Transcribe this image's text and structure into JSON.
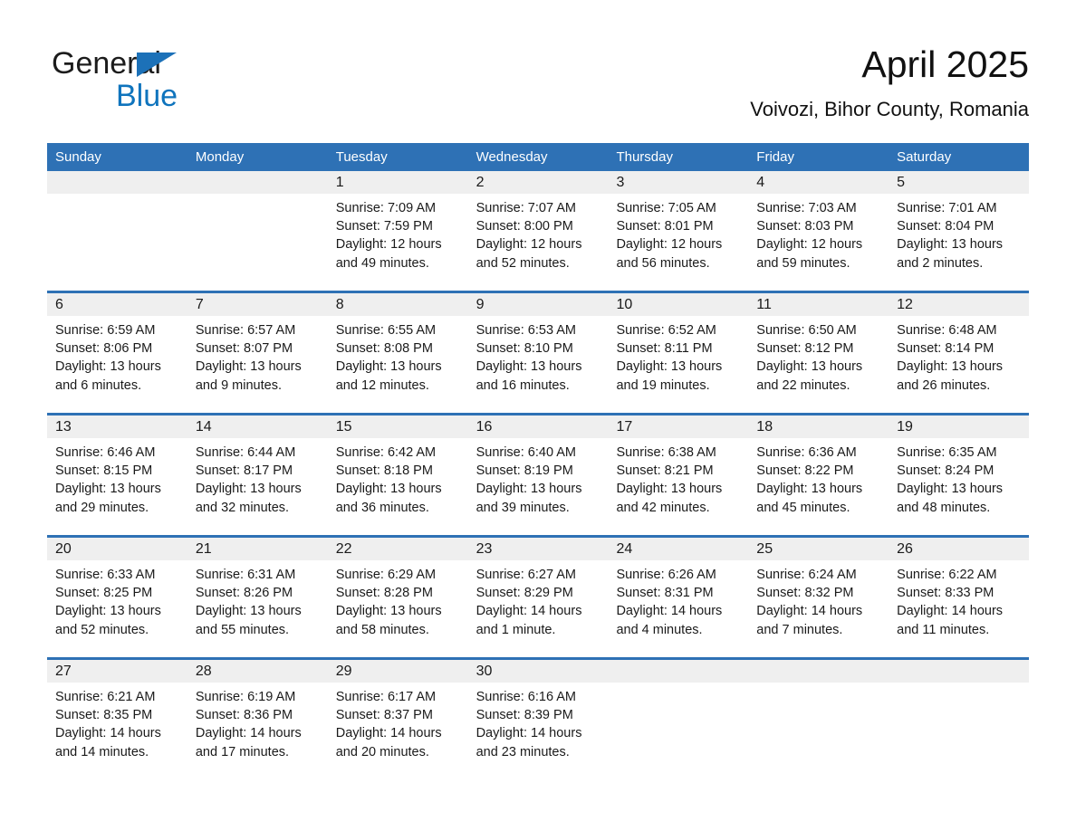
{
  "brand": {
    "name_part1": "General",
    "name_part2": "Blue",
    "logo_icon": "triangle-logo-icon",
    "accent_color": "#1c71b8"
  },
  "header": {
    "title": "April 2025",
    "subtitle": "Voivozi, Bihor County, Romania"
  },
  "theme": {
    "header_blue": "#2e71b5",
    "daynum_band": "#efefef",
    "text": "#1a1a1a"
  },
  "calendar": {
    "weekdays": [
      "Sunday",
      "Monday",
      "Tuesday",
      "Wednesday",
      "Thursday",
      "Friday",
      "Saturday"
    ],
    "weeks": [
      [
        {
          "day": "",
          "lines": []
        },
        {
          "day": "",
          "lines": []
        },
        {
          "day": "1",
          "lines": [
            "Sunrise: 7:09 AM",
            "Sunset: 7:59 PM",
            "Daylight: 12 hours",
            "and 49 minutes."
          ]
        },
        {
          "day": "2",
          "lines": [
            "Sunrise: 7:07 AM",
            "Sunset: 8:00 PM",
            "Daylight: 12 hours",
            "and 52 minutes."
          ]
        },
        {
          "day": "3",
          "lines": [
            "Sunrise: 7:05 AM",
            "Sunset: 8:01 PM",
            "Daylight: 12 hours",
            "and 56 minutes."
          ]
        },
        {
          "day": "4",
          "lines": [
            "Sunrise: 7:03 AM",
            "Sunset: 8:03 PM",
            "Daylight: 12 hours",
            "and 59 minutes."
          ]
        },
        {
          "day": "5",
          "lines": [
            "Sunrise: 7:01 AM",
            "Sunset: 8:04 PM",
            "Daylight: 13 hours",
            "and 2 minutes."
          ]
        }
      ],
      [
        {
          "day": "6",
          "lines": [
            "Sunrise: 6:59 AM",
            "Sunset: 8:06 PM",
            "Daylight: 13 hours",
            "and 6 minutes."
          ]
        },
        {
          "day": "7",
          "lines": [
            "Sunrise: 6:57 AM",
            "Sunset: 8:07 PM",
            "Daylight: 13 hours",
            "and 9 minutes."
          ]
        },
        {
          "day": "8",
          "lines": [
            "Sunrise: 6:55 AM",
            "Sunset: 8:08 PM",
            "Daylight: 13 hours",
            "and 12 minutes."
          ]
        },
        {
          "day": "9",
          "lines": [
            "Sunrise: 6:53 AM",
            "Sunset: 8:10 PM",
            "Daylight: 13 hours",
            "and 16 minutes."
          ]
        },
        {
          "day": "10",
          "lines": [
            "Sunrise: 6:52 AM",
            "Sunset: 8:11 PM",
            "Daylight: 13 hours",
            "and 19 minutes."
          ]
        },
        {
          "day": "11",
          "lines": [
            "Sunrise: 6:50 AM",
            "Sunset: 8:12 PM",
            "Daylight: 13 hours",
            "and 22 minutes."
          ]
        },
        {
          "day": "12",
          "lines": [
            "Sunrise: 6:48 AM",
            "Sunset: 8:14 PM",
            "Daylight: 13 hours",
            "and 26 minutes."
          ]
        }
      ],
      [
        {
          "day": "13",
          "lines": [
            "Sunrise: 6:46 AM",
            "Sunset: 8:15 PM",
            "Daylight: 13 hours",
            "and 29 minutes."
          ]
        },
        {
          "day": "14",
          "lines": [
            "Sunrise: 6:44 AM",
            "Sunset: 8:17 PM",
            "Daylight: 13 hours",
            "and 32 minutes."
          ]
        },
        {
          "day": "15",
          "lines": [
            "Sunrise: 6:42 AM",
            "Sunset: 8:18 PM",
            "Daylight: 13 hours",
            "and 36 minutes."
          ]
        },
        {
          "day": "16",
          "lines": [
            "Sunrise: 6:40 AM",
            "Sunset: 8:19 PM",
            "Daylight: 13 hours",
            "and 39 minutes."
          ]
        },
        {
          "day": "17",
          "lines": [
            "Sunrise: 6:38 AM",
            "Sunset: 8:21 PM",
            "Daylight: 13 hours",
            "and 42 minutes."
          ]
        },
        {
          "day": "18",
          "lines": [
            "Sunrise: 6:36 AM",
            "Sunset: 8:22 PM",
            "Daylight: 13 hours",
            "and 45 minutes."
          ]
        },
        {
          "day": "19",
          "lines": [
            "Sunrise: 6:35 AM",
            "Sunset: 8:24 PM",
            "Daylight: 13 hours",
            "and 48 minutes."
          ]
        }
      ],
      [
        {
          "day": "20",
          "lines": [
            "Sunrise: 6:33 AM",
            "Sunset: 8:25 PM",
            "Daylight: 13 hours",
            "and 52 minutes."
          ]
        },
        {
          "day": "21",
          "lines": [
            "Sunrise: 6:31 AM",
            "Sunset: 8:26 PM",
            "Daylight: 13 hours",
            "and 55 minutes."
          ]
        },
        {
          "day": "22",
          "lines": [
            "Sunrise: 6:29 AM",
            "Sunset: 8:28 PM",
            "Daylight: 13 hours",
            "and 58 minutes."
          ]
        },
        {
          "day": "23",
          "lines": [
            "Sunrise: 6:27 AM",
            "Sunset: 8:29 PM",
            "Daylight: 14 hours",
            "and 1 minute."
          ]
        },
        {
          "day": "24",
          "lines": [
            "Sunrise: 6:26 AM",
            "Sunset: 8:31 PM",
            "Daylight: 14 hours",
            "and 4 minutes."
          ]
        },
        {
          "day": "25",
          "lines": [
            "Sunrise: 6:24 AM",
            "Sunset: 8:32 PM",
            "Daylight: 14 hours",
            "and 7 minutes."
          ]
        },
        {
          "day": "26",
          "lines": [
            "Sunrise: 6:22 AM",
            "Sunset: 8:33 PM",
            "Daylight: 14 hours",
            "and 11 minutes."
          ]
        }
      ],
      [
        {
          "day": "27",
          "lines": [
            "Sunrise: 6:21 AM",
            "Sunset: 8:35 PM",
            "Daylight: 14 hours",
            "and 14 minutes."
          ]
        },
        {
          "day": "28",
          "lines": [
            "Sunrise: 6:19 AM",
            "Sunset: 8:36 PM",
            "Daylight: 14 hours",
            "and 17 minutes."
          ]
        },
        {
          "day": "29",
          "lines": [
            "Sunrise: 6:17 AM",
            "Sunset: 8:37 PM",
            "Daylight: 14 hours",
            "and 20 minutes."
          ]
        },
        {
          "day": "30",
          "lines": [
            "Sunrise: 6:16 AM",
            "Sunset: 8:39 PM",
            "Daylight: 14 hours",
            "and 23 minutes."
          ]
        },
        {
          "day": "",
          "lines": []
        },
        {
          "day": "",
          "lines": []
        },
        {
          "day": "",
          "lines": []
        }
      ]
    ]
  }
}
